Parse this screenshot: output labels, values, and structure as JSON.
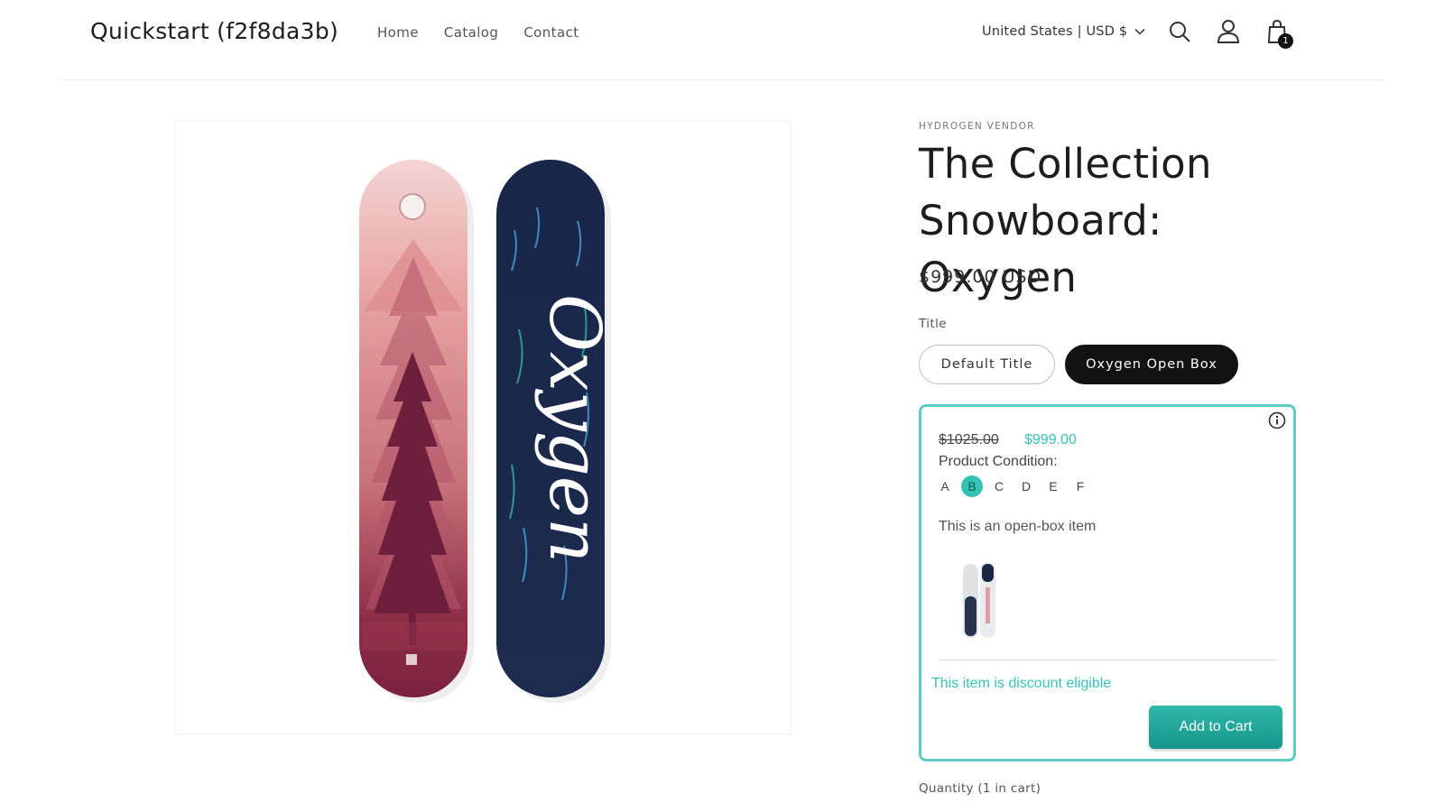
{
  "header": {
    "brand": "Quickstart (f2f8da3b)",
    "nav": [
      "Home",
      "Catalog",
      "Contact"
    ],
    "locale": "United States | USD $",
    "cart_count": "1",
    "icons": [
      "search-icon",
      "account-icon",
      "cart-icon",
      "chevron-down-icon"
    ]
  },
  "product": {
    "vendor": "HYDROGEN VENDOR",
    "title": "The Collection Snowboard: Oxygen",
    "price": "$999.00 USD",
    "option_label": "Title",
    "options": [
      "Default Title",
      "Oxygen Open Box"
    ],
    "selected_option": "Oxygen Open Box",
    "quantity_label": "Quantity (1 in cart)",
    "board_text": "Oxygen"
  },
  "open_box": {
    "original_price": "$1025.00",
    "sale_price": "$999.00",
    "condition_label": "Product Condition:",
    "grades": [
      "A",
      "B",
      "C",
      "D",
      "E",
      "F"
    ],
    "selected_grade": "B",
    "description": "This is an open-box item",
    "discount_text": "This item is discount eligible",
    "add_to_cart": "Add to Cart",
    "accent_color": "#35c4b4"
  }
}
